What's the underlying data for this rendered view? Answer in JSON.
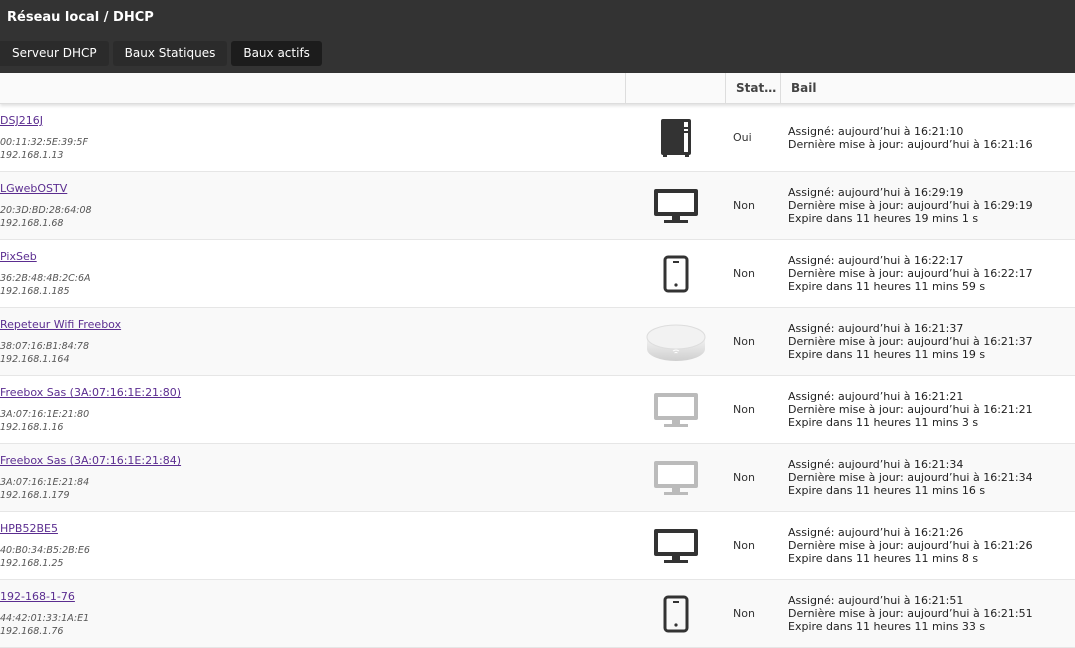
{
  "header": {
    "title": "Réseau local / DHCP",
    "tabs": [
      {
        "label": "Serveur DHCP"
      },
      {
        "label": "Baux Statiques"
      },
      {
        "label": "Baux actifs",
        "active": true
      }
    ]
  },
  "table": {
    "columns": [
      "",
      "",
      "Stat…",
      "Bail"
    ],
    "rows": [
      {
        "name": "DSJ216J",
        "mac": "00:11:32:5E:39:5F",
        "ip": "192.168.1.13",
        "icon": "nas-icon",
        "status": "Oui",
        "lease": [
          "Assigné: aujourd’hui à 16:21:10",
          "Dernière mise à jour: aujourd’hui à 16:21:16"
        ]
      },
      {
        "name": "LGwebOSTV",
        "mac": "20:3D:BD:28:64:08",
        "ip": "192.168.1.68",
        "icon": "monitor-icon",
        "status": "Non",
        "lease": [
          "Assigné: aujourd’hui à 16:29:19",
          "Dernière mise à jour: aujourd’hui à 16:29:19",
          "Expire dans 11 heures 19 mins 1 s"
        ]
      },
      {
        "name": "PixSeb",
        "mac": "36:2B:48:4B:2C:6A",
        "ip": "192.168.1.185",
        "icon": "phone-icon",
        "status": "Non",
        "lease": [
          "Assigné: aujourd’hui à 16:22:17",
          "Dernière mise à jour: aujourd’hui à 16:22:17",
          "Expire dans 11 heures 11 mins 59 s"
        ]
      },
      {
        "name": "Repeteur Wifi Freebox",
        "mac": "38:07:16:B1:84:78",
        "ip": "192.168.1.164",
        "icon": "wifi-repeater-icon",
        "status": "Non",
        "lease": [
          "Assigné: aujourd’hui à 16:21:37",
          "Dernière mise à jour: aujourd’hui à 16:21:37",
          "Expire dans 11 heures 11 mins 19 s"
        ]
      },
      {
        "name": "Freebox Sas (3A:07:16:1E:21:80)",
        "mac": "3A:07:16:1E:21:80",
        "ip": "192.168.1.16",
        "icon": "monitor-inactive-icon",
        "status": "Non",
        "lease": [
          "Assigné: aujourd’hui à 16:21:21",
          "Dernière mise à jour: aujourd’hui à 16:21:21",
          "Expire dans 11 heures 11 mins 3 s"
        ]
      },
      {
        "name": "Freebox Sas (3A:07:16:1E:21:84)",
        "mac": "3A:07:16:1E:21:84",
        "ip": "192.168.1.179",
        "icon": "monitor-inactive-icon",
        "status": "Non",
        "lease": [
          "Assigné: aujourd’hui à 16:21:34",
          "Dernière mise à jour: aujourd’hui à 16:21:34",
          "Expire dans 11 heures 11 mins 16 s"
        ]
      },
      {
        "name": "HPB52BE5",
        "mac": "40:B0:34:B5:2B:E6",
        "ip": "192.168.1.25",
        "icon": "monitor-icon",
        "status": "Non",
        "lease": [
          "Assigné: aujourd’hui à 16:21:26",
          "Dernière mise à jour: aujourd’hui à 16:21:26",
          "Expire dans 11 heures 11 mins 8 s"
        ]
      },
      {
        "name": "192-168-1-76",
        "mac": "44:42:01:33:1A:E1",
        "ip": "192.168.1.76",
        "icon": "phone-icon",
        "status": "Non",
        "lease": [
          "Assigné: aujourd’hui à 16:21:51",
          "Dernière mise à jour: aujourd’hui à 16:21:51",
          "Expire dans 11 heures 11 mins 33 s"
        ]
      }
    ]
  }
}
